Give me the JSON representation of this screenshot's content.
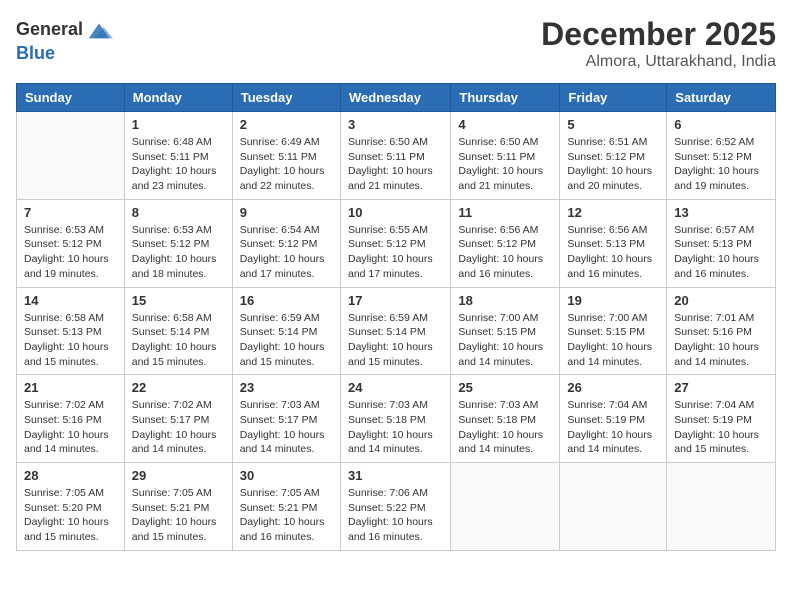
{
  "header": {
    "logo_general": "General",
    "logo_blue": "Blue",
    "month_title": "December 2025",
    "location": "Almora, Uttarakhand, India"
  },
  "days_of_week": [
    "Sunday",
    "Monday",
    "Tuesday",
    "Wednesday",
    "Thursday",
    "Friday",
    "Saturday"
  ],
  "weeks": [
    [
      {
        "day": "",
        "empty": true
      },
      {
        "day": "1",
        "sunrise": "6:48 AM",
        "sunset": "5:11 PM",
        "daylight": "10 hours and 23 minutes."
      },
      {
        "day": "2",
        "sunrise": "6:49 AM",
        "sunset": "5:11 PM",
        "daylight": "10 hours and 22 minutes."
      },
      {
        "day": "3",
        "sunrise": "6:50 AM",
        "sunset": "5:11 PM",
        "daylight": "10 hours and 21 minutes."
      },
      {
        "day": "4",
        "sunrise": "6:50 AM",
        "sunset": "5:11 PM",
        "daylight": "10 hours and 21 minutes."
      },
      {
        "day": "5",
        "sunrise": "6:51 AM",
        "sunset": "5:12 PM",
        "daylight": "10 hours and 20 minutes."
      },
      {
        "day": "6",
        "sunrise": "6:52 AM",
        "sunset": "5:12 PM",
        "daylight": "10 hours and 19 minutes."
      }
    ],
    [
      {
        "day": "7",
        "sunrise": "6:53 AM",
        "sunset": "5:12 PM",
        "daylight": "10 hours and 19 minutes."
      },
      {
        "day": "8",
        "sunrise": "6:53 AM",
        "sunset": "5:12 PM",
        "daylight": "10 hours and 18 minutes."
      },
      {
        "day": "9",
        "sunrise": "6:54 AM",
        "sunset": "5:12 PM",
        "daylight": "10 hours and 17 minutes."
      },
      {
        "day": "10",
        "sunrise": "6:55 AM",
        "sunset": "5:12 PM",
        "daylight": "10 hours and 17 minutes."
      },
      {
        "day": "11",
        "sunrise": "6:56 AM",
        "sunset": "5:12 PM",
        "daylight": "10 hours and 16 minutes."
      },
      {
        "day": "12",
        "sunrise": "6:56 AM",
        "sunset": "5:13 PM",
        "daylight": "10 hours and 16 minutes."
      },
      {
        "day": "13",
        "sunrise": "6:57 AM",
        "sunset": "5:13 PM",
        "daylight": "10 hours and 16 minutes."
      }
    ],
    [
      {
        "day": "14",
        "sunrise": "6:58 AM",
        "sunset": "5:13 PM",
        "daylight": "10 hours and 15 minutes."
      },
      {
        "day": "15",
        "sunrise": "6:58 AM",
        "sunset": "5:14 PM",
        "daylight": "10 hours and 15 minutes."
      },
      {
        "day": "16",
        "sunrise": "6:59 AM",
        "sunset": "5:14 PM",
        "daylight": "10 hours and 15 minutes."
      },
      {
        "day": "17",
        "sunrise": "6:59 AM",
        "sunset": "5:14 PM",
        "daylight": "10 hours and 15 minutes."
      },
      {
        "day": "18",
        "sunrise": "7:00 AM",
        "sunset": "5:15 PM",
        "daylight": "10 hours and 14 minutes."
      },
      {
        "day": "19",
        "sunrise": "7:00 AM",
        "sunset": "5:15 PM",
        "daylight": "10 hours and 14 minutes."
      },
      {
        "day": "20",
        "sunrise": "7:01 AM",
        "sunset": "5:16 PM",
        "daylight": "10 hours and 14 minutes."
      }
    ],
    [
      {
        "day": "21",
        "sunrise": "7:02 AM",
        "sunset": "5:16 PM",
        "daylight": "10 hours and 14 minutes."
      },
      {
        "day": "22",
        "sunrise": "7:02 AM",
        "sunset": "5:17 PM",
        "daylight": "10 hours and 14 minutes."
      },
      {
        "day": "23",
        "sunrise": "7:03 AM",
        "sunset": "5:17 PM",
        "daylight": "10 hours and 14 minutes."
      },
      {
        "day": "24",
        "sunrise": "7:03 AM",
        "sunset": "5:18 PM",
        "daylight": "10 hours and 14 minutes."
      },
      {
        "day": "25",
        "sunrise": "7:03 AM",
        "sunset": "5:18 PM",
        "daylight": "10 hours and 14 minutes."
      },
      {
        "day": "26",
        "sunrise": "7:04 AM",
        "sunset": "5:19 PM",
        "daylight": "10 hours and 14 minutes."
      },
      {
        "day": "27",
        "sunrise": "7:04 AM",
        "sunset": "5:19 PM",
        "daylight": "10 hours and 15 minutes."
      }
    ],
    [
      {
        "day": "28",
        "sunrise": "7:05 AM",
        "sunset": "5:20 PM",
        "daylight": "10 hours and 15 minutes."
      },
      {
        "day": "29",
        "sunrise": "7:05 AM",
        "sunset": "5:21 PM",
        "daylight": "10 hours and 15 minutes."
      },
      {
        "day": "30",
        "sunrise": "7:05 AM",
        "sunset": "5:21 PM",
        "daylight": "10 hours and 16 minutes."
      },
      {
        "day": "31",
        "sunrise": "7:06 AM",
        "sunset": "5:22 PM",
        "daylight": "10 hours and 16 minutes."
      },
      {
        "day": "",
        "empty": true
      },
      {
        "day": "",
        "empty": true
      },
      {
        "day": "",
        "empty": true
      }
    ]
  ],
  "labels": {
    "sunrise_prefix": "Sunrise: ",
    "sunset_prefix": "Sunset: ",
    "daylight_prefix": "Daylight: "
  }
}
